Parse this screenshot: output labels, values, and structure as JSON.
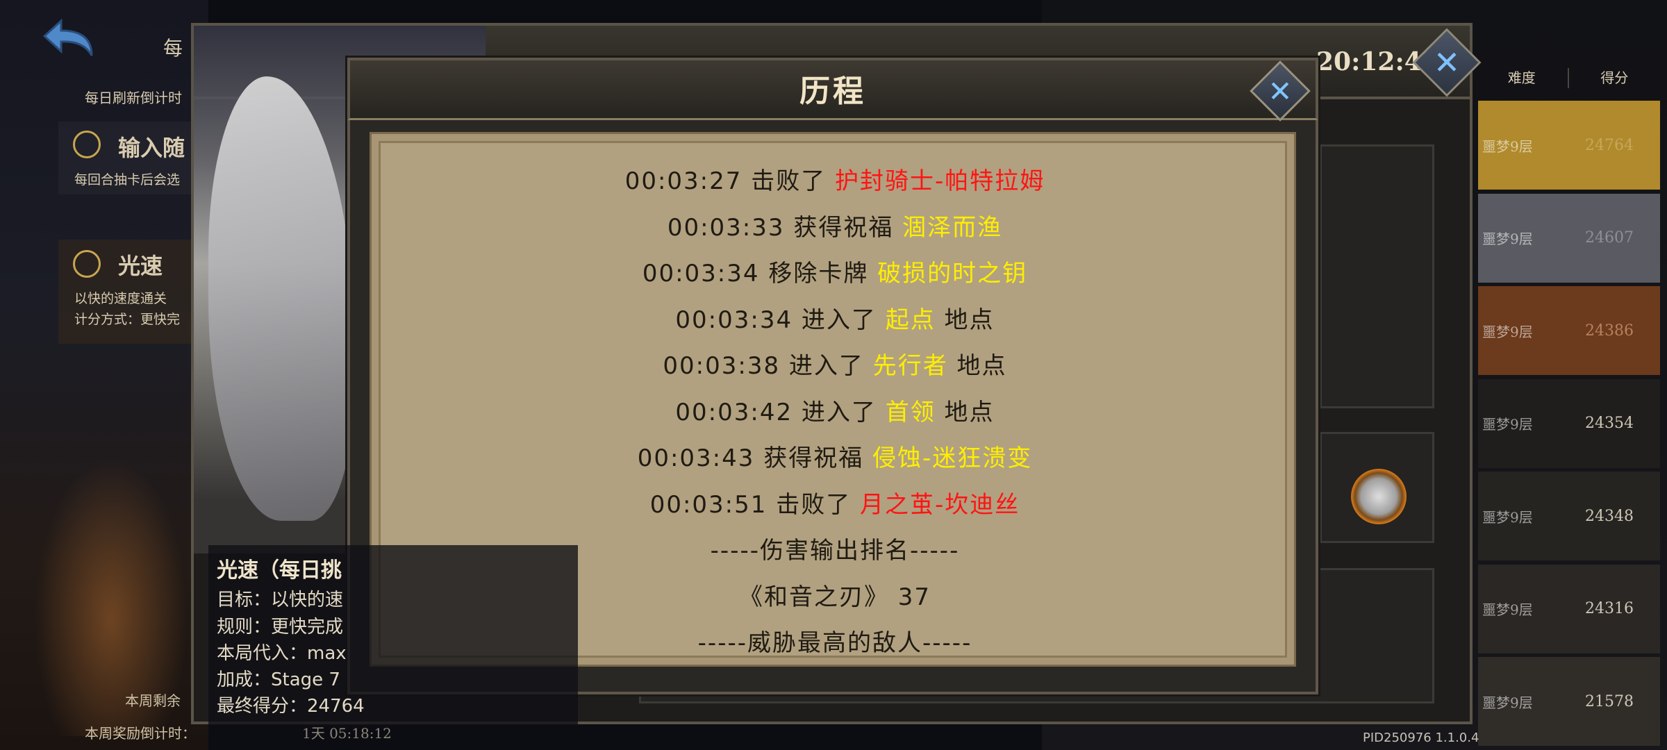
{
  "left": {
    "header_title": "每",
    "refresh_label": "每日刷新倒计时",
    "mode1_title": "输入随",
    "mode1_desc": "每回合抽卡后会选",
    "mode2_title": "光速",
    "mode2_desc1": "以快的速度通关",
    "mode2_desc2": "计分方式：更快完",
    "week_left_label": "本周剩余",
    "week_reward_label": "本周奖励倒计时：",
    "week_reward_value": "1天 05:18:12"
  },
  "main_dialog": {
    "timer": "20:12:42"
  },
  "scoreboard": {
    "headers": [
      "难度",
      "得分"
    ],
    "rows": [
      {
        "difficulty": "噩梦9层",
        "score": "24764",
        "color": "#b08a2c",
        "text": "#c7a85a"
      },
      {
        "difficulty": "噩梦9层",
        "score": "24607",
        "color": "#5a5b62",
        "text": "#8e8f97"
      },
      {
        "difficulty": "噩梦9层",
        "score": "24386",
        "color": "#6c3a1c",
        "text": "#b5835e"
      },
      {
        "difficulty": "噩梦9层",
        "score": "24354",
        "color": "#1f1e1c",
        "text": "#cfc7b6"
      },
      {
        "difficulty": "噩梦9层",
        "score": "24348",
        "color": "#262421",
        "text": "#cfc7b6"
      },
      {
        "difficulty": "噩梦9层",
        "score": "24316",
        "color": "#2a2724",
        "text": "#cfc7b6"
      },
      {
        "difficulty": "噩梦9层",
        "score": "21578",
        "color": "#302d29",
        "text": "#cfc7b6"
      }
    ]
  },
  "history": {
    "title": "历程",
    "lines": [
      {
        "prefix": "00:03:27 击败了 ",
        "highlight": "护封骑士-帕特拉姆",
        "suffix": "",
        "color": "red"
      },
      {
        "prefix": "00:03:33 获得祝福 ",
        "highlight": "涸泽而渔",
        "suffix": "",
        "color": "yellow"
      },
      {
        "prefix": "00:03:34 移除卡牌 ",
        "highlight": "破损的时之钥",
        "suffix": "",
        "color": "yellow"
      },
      {
        "prefix": "00:03:34 进入了 ",
        "highlight": "起点",
        "suffix": " 地点",
        "color": "yellow"
      },
      {
        "prefix": "00:03:38 进入了 ",
        "highlight": "先行者",
        "suffix": " 地点",
        "color": "yellow"
      },
      {
        "prefix": "00:03:42 进入了 ",
        "highlight": "首领",
        "suffix": " 地点",
        "color": "yellow"
      },
      {
        "prefix": "00:03:43 获得祝福 ",
        "highlight": "侵蚀-迷狂溃变",
        "suffix": "",
        "color": "yellow"
      },
      {
        "prefix": "00:03:51 击败了 ",
        "highlight": "月之茧-坎迪丝",
        "suffix": "",
        "color": "red"
      },
      {
        "prefix": "-----伤害输出排名-----",
        "highlight": "",
        "suffix": "",
        "color": "none"
      },
      {
        "prefix": "《和音之刃》  37",
        "highlight": "",
        "suffix": "",
        "color": "none"
      },
      {
        "prefix": "-----威胁最高的敌人-----",
        "highlight": "",
        "suffix": "",
        "color": "none"
      }
    ]
  },
  "info": {
    "title": "光速（每日挑",
    "goal": "目标：以快的速",
    "rule": "规则：更快完成",
    "substitute": "本局代入：max",
    "bonus": "加成：Stage 7",
    "final_score": "最终得分：24764"
  },
  "version": "PID250976  1.1.0.4"
}
